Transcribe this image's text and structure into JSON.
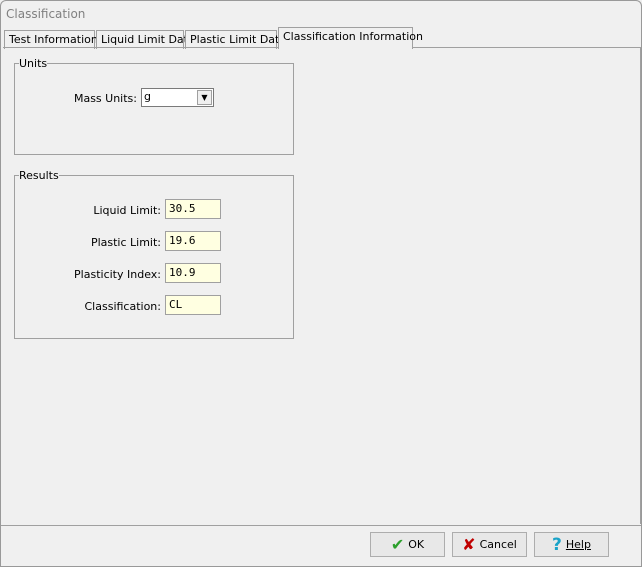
{
  "window": {
    "title": "Classification"
  },
  "tabs": [
    {
      "label": "Test Information"
    },
    {
      "label": "Liquid Limit Data"
    },
    {
      "label": "Plastic Limit Data"
    },
    {
      "label": "Classification Information",
      "active": true
    }
  ],
  "units": {
    "legend": "Units",
    "mass_label": "Mass Units:",
    "mass_value": "g"
  },
  "results": {
    "legend": "Results",
    "liquid_limit_label": "Liquid Limit:",
    "liquid_limit": "30.5",
    "plastic_limit_label": "Plastic Limit:",
    "plastic_limit": "19.6",
    "plasticity_index_label": "Plasticity Index:",
    "plasticity_index": "10.9",
    "classification_label": "Classification:",
    "classification": "CL"
  },
  "buttons": {
    "ok": "OK",
    "cancel": "Cancel",
    "help": "Help"
  },
  "colors": {
    "field_bg": "#ffffe1",
    "ok_icon": "#2ca02c",
    "cancel_icon": "#c00000",
    "help_icon": "#1aa3c8"
  }
}
